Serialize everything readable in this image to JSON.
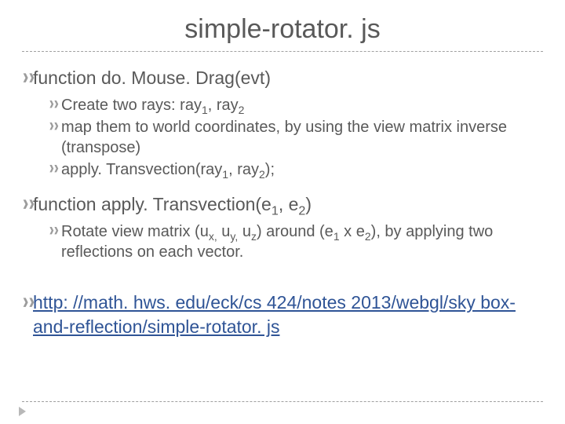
{
  "title": "simple-rotator. js",
  "sections": [
    {
      "heading": {
        "pre": "function do. Mouse. Drag(evt)"
      },
      "items": [
        {
          "pre": "Create two rays: ray",
          "s1": "1",
          "mid1": ", ray",
          "s2": "2"
        },
        {
          "pre": "map them to world coordinates, by using the view matrix inverse (transpose)"
        },
        {
          "pre": "apply. Transvection(ray",
          "s1": "1",
          "mid1": ", ray",
          "s2": "2",
          "post": ");"
        }
      ]
    },
    {
      "heading": {
        "pre": "function apply. Transvection(e",
        "s1": "1",
        "mid1": ", e",
        "s2": "2",
        "post": ")"
      },
      "items": [
        {
          "pre": "Rotate view matrix (u",
          "s1": "x,",
          "mid1": " u",
          "s2": "y,",
          "mid2": " u",
          "s3": "z",
          "post": ") around (e",
          "s4": "1",
          "mid3": " x e",
          "s5": "2",
          "tail": "), by applying two reflections on each vector."
        }
      ]
    },
    {
      "heading": {
        "link": "http: //math. hws. edu/eck/cs 424/notes 2013/webgl/sky box-and-reflection/simple-rotator. js"
      }
    }
  ]
}
